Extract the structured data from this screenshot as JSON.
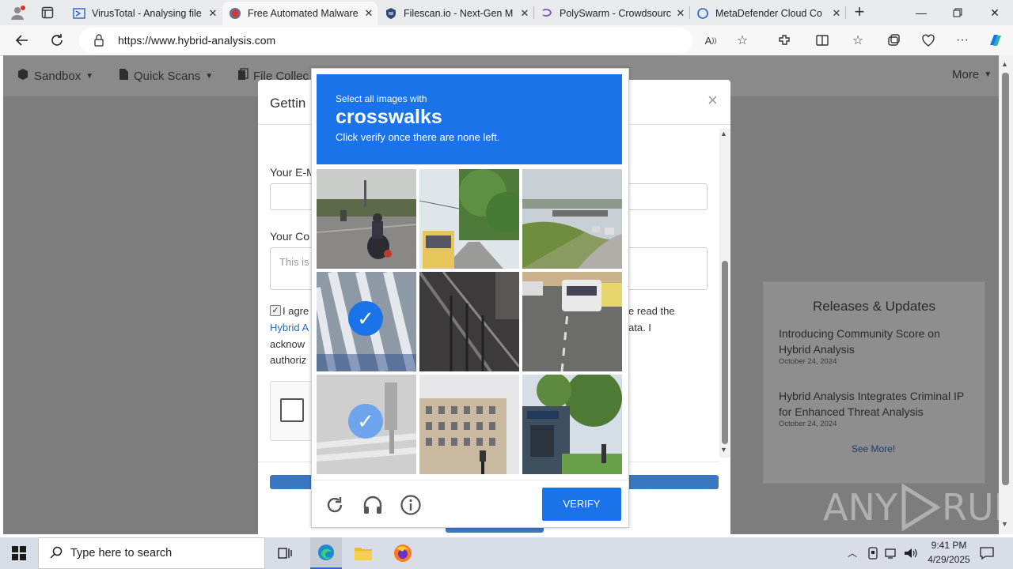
{
  "browser": {
    "tabs": [
      {
        "title": "VirusTotal - Analysing file",
        "icon": "virustotal-icon"
      },
      {
        "title": "Free Automated Malware",
        "icon": "hybrid-analysis-icon"
      },
      {
        "title": "Filescan.io - Next-Gen M",
        "icon": "filescan-icon"
      },
      {
        "title": "PolySwarm - Crowdsourc",
        "icon": "polyswarm-icon"
      },
      {
        "title": "MetaDefender Cloud Co",
        "icon": "metadefender-icon"
      }
    ],
    "active_tab_index": 1,
    "url": "https://www.hybrid-analysis.com"
  },
  "site": {
    "nav": {
      "sandbox": "Sandbox",
      "quick_scans": "Quick Scans",
      "file_collections": "File Collec",
      "more": "More"
    },
    "releases": {
      "title": "Releases & Updates",
      "items": [
        {
          "title": "Introducing Community Score on Hybrid Analysis",
          "date": "October 24, 2024"
        },
        {
          "title": "Hybrid Analysis Integrates Criminal IP for Enhanced Threat Analysis",
          "date": "October 24, 2024"
        }
      ],
      "see_more": "See More!"
    }
  },
  "modal": {
    "title": "Gettin",
    "close": "×",
    "email_label": "Your E-M",
    "comment_label": "Your Co",
    "comment_placeholder": "This is",
    "agree_prefix": "I agre",
    "agree_right_1": "e read the",
    "link": "Hybrid A",
    "agree_right_2": "ata. I",
    "line3": "acknow",
    "line4": "authoriz"
  },
  "captcha": {
    "prompt_small": "Select all images with",
    "keyword": "crosswalks",
    "instruction": "Click verify once there are none left.",
    "tiles": [
      {
        "subject": "motorcycle on road",
        "selected": false
      },
      {
        "subject": "bus on tree-lined street",
        "selected": false
      },
      {
        "subject": "highway overpass",
        "selected": false
      },
      {
        "subject": "crosswalk",
        "selected": true
      },
      {
        "subject": "staircase",
        "selected": false
      },
      {
        "subject": "traffic with vans",
        "selected": false
      },
      {
        "subject": "crosswalk with pedestrian",
        "selected": true
      },
      {
        "subject": "building",
        "selected": false
      },
      {
        "subject": "station entrance",
        "selected": false
      }
    ],
    "verify_label": "VERIFY"
  },
  "watermark": "ANY RUN",
  "taskbar": {
    "search_placeholder": "Type here to search",
    "time": "9:41 PM",
    "date": "4/29/2025"
  },
  "colors": {
    "captcha_blue": "#1a73e8",
    "modal_button": "#3a77c0"
  }
}
